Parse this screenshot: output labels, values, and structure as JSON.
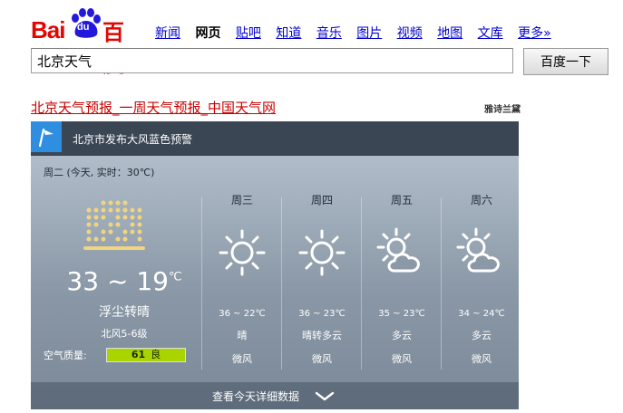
{
  "logo": {
    "text_bai": "Bai",
    "text_du": "du",
    "text_cn": "百度"
  },
  "nav": {
    "items": [
      {
        "label": "新闻"
      },
      {
        "label": "网页"
      },
      {
        "label": "贴吧"
      },
      {
        "label": "知道"
      },
      {
        "label": "音乐"
      },
      {
        "label": "图片"
      },
      {
        "label": "视频"
      },
      {
        "label": "地图"
      },
      {
        "label": "文库"
      },
      {
        "label": "更多»"
      }
    ],
    "active": "网页"
  },
  "search": {
    "value": "北京天气",
    "button_label": "百度一下"
  },
  "result": {
    "title": "北京天气预报_一周天气预报_中国天气网",
    "sponsor": "雅诗兰黛"
  },
  "alert": {
    "text": "北京市发布大风蓝色预警"
  },
  "today": {
    "label": "周二 (今天, 实时：30℃)",
    "temp": "33 ~ 19",
    "unit": "℃",
    "condition": "浮尘转晴",
    "wind": "北风5-6级",
    "air_quality_label": "空气质量:",
    "aqi": "61",
    "aqi_level": "良",
    "icon": "dust-icon"
  },
  "forecast": [
    {
      "day": "周三",
      "range": "36 ~ 22℃",
      "condition": "晴",
      "wind": "微风",
      "icon": "sun-icon"
    },
    {
      "day": "周四",
      "range": "36 ~ 23℃",
      "condition": "晴转多云",
      "wind": "微风",
      "icon": "sun-icon"
    },
    {
      "day": "周五",
      "range": "35 ~ 23℃",
      "condition": "多云",
      "wind": "微风",
      "icon": "sun-cloud-icon"
    },
    {
      "day": "周六",
      "range": "34 ~ 24℃",
      "condition": "多云",
      "wind": "微风",
      "icon": "sun-cloud-icon"
    }
  ],
  "footer": {
    "label": "查看今天详细数据"
  },
  "colors": {
    "brand_red": "#e10601",
    "brand_blue": "#2319dc",
    "aqi_good": "#a9d400",
    "flag_blue": "#2f8ee0",
    "link": "#0000cc"
  }
}
